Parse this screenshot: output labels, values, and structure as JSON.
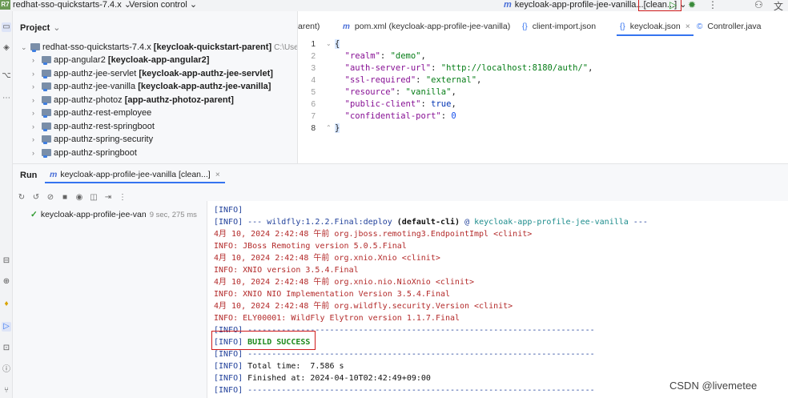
{
  "topbar": {
    "project_badge": "R7",
    "project_name": "redhat-sso-quickstarts-7.4.x",
    "version_control": "Version control",
    "run_config_prefix": "m",
    "run_config": "keycloak-app-profile-jee-vanilla...[clean...]",
    "icons": [
      "chevron-down-icon",
      "run-icon",
      "debug-icon",
      "more-icon",
      "add-user-icon",
      "translate-icon"
    ]
  },
  "project_panel": {
    "title": "Project",
    "items": [
      {
        "label": "redhat-sso-quickstarts-7.4.x",
        "module": "[keycloak-quickstart-parent]",
        "path": "C:\\Users\\Len",
        "expanded": true,
        "level": 0
      },
      {
        "label": "app-angular2",
        "module": "[keycloak-app-angular2]",
        "level": 1
      },
      {
        "label": "app-authz-jee-servlet",
        "module": "[keycloak-app-authz-jee-servlet]",
        "level": 1
      },
      {
        "label": "app-authz-jee-vanilla",
        "module": "[keycloak-app-authz-jee-vanilla]",
        "level": 1
      },
      {
        "label": "app-authz-photoz",
        "module": "[app-authz-photoz-parent]",
        "level": 1
      },
      {
        "label": "app-authz-rest-employee",
        "module": "",
        "level": 1
      },
      {
        "label": "app-authz-rest-springboot",
        "module": "",
        "level": 1
      },
      {
        "label": "app-authz-spring-security",
        "module": "",
        "level": 1
      },
      {
        "label": "app-authz-springboot",
        "module": "",
        "level": 1
      }
    ]
  },
  "editor": {
    "tabs": [
      {
        "label": "arent)",
        "icon": ""
      },
      {
        "label": "pom.xml (keycloak-app-profile-jee-vanilla)",
        "icon": "m"
      },
      {
        "label": "client-import.json",
        "icon": "{}"
      },
      {
        "label": "keycloak.json",
        "icon": "{}",
        "active": true,
        "close": "×"
      },
      {
        "label": "Controller.java",
        "icon": "©"
      }
    ],
    "line_numbers": [
      "1",
      "2",
      "3",
      "4",
      "5",
      "6",
      "7",
      "8"
    ],
    "code": {
      "l1": "{",
      "realm_key": "\"realm\"",
      "realm_val": "\"demo\"",
      "auth_key": "\"auth-server-url\"",
      "auth_val": "\"http://localhost:8180/auth/\"",
      "ssl_key": "\"ssl-required\"",
      "ssl_val": "\"external\"",
      "res_key": "\"resource\"",
      "res_val": "\"vanilla\"",
      "pub_key": "\"public-client\"",
      "pub_val": "true",
      "conf_key": "\"confidential-port\"",
      "conf_val": "0",
      "l8": "}"
    }
  },
  "run_panel": {
    "label": "Run",
    "tab_prefix": "m",
    "tab": "keycloak-app-profile-jee-vanilla [clean...]",
    "tab_close": "×",
    "toolbar_icons": [
      "rerun-icon",
      "rerun-failed-icon",
      "stop-icon",
      "stop-square-icon",
      "view-icon",
      "camera-icon",
      "export-icon",
      "more-icon"
    ],
    "tree_item": "keycloak-app-profile-jee-van",
    "tree_duration": "9 sec, 275 ms"
  },
  "console": {
    "l1_tag": "[INFO]",
    "l2_tag": "[INFO]",
    "l2_pre": " --- wildfly:1.2.2.Final:deploy ",
    "l2_bold": "(default-cli)",
    "l2_at": " @ ",
    "l2_cyan": "keycloak-app-profile-jee-vanilla",
    "l2_post": " ---",
    "l3": "4月 10, 2024 2:42:48 午前 org.jboss.remoting3.EndpointImpl <clinit>",
    "l4": "INFO: JBoss Remoting version 5.0.5.Final",
    "l5": "4月 10, 2024 2:42:48 午前 org.xnio.Xnio <clinit>",
    "l6": "INFO: XNIO version 3.5.4.Final",
    "l7": "4月 10, 2024 2:42:48 午前 org.xnio.nio.NioXnio <clinit>",
    "l8": "INFO: XNIO NIO Implementation Version 3.5.4.Final",
    "l9": "4月 10, 2024 2:42:48 午前 org.wildfly.security.Version <clinit>",
    "l10": "INFO: ELY00001: WildFly Elytron version 1.1.7.Final",
    "l11_tag": "[INFO]",
    "l11_rule": " ------------------------------------------------------------------------",
    "l12_tag": "[INFO]",
    "l12_green": " BUILD SUCCESS",
    "l13_tag": "[INFO]",
    "l13_rule": " ------------------------------------------------------------------------",
    "l14_tag": "[INFO]",
    "l14_text": " Total time:  7.586 s",
    "l15_tag": "[INFO]",
    "l15_text": " Finished at: 2024-04-10T02:42:49+09:00",
    "l16_tag": "[INFO]",
    "l16_rule": " ------------------------------------------------------------------------"
  },
  "watermark": "CSDN @livemetee",
  "colors": {
    "accent": "#3574f0",
    "highlight_red": "#d01b1b",
    "success_green": "#1e8a1e"
  }
}
